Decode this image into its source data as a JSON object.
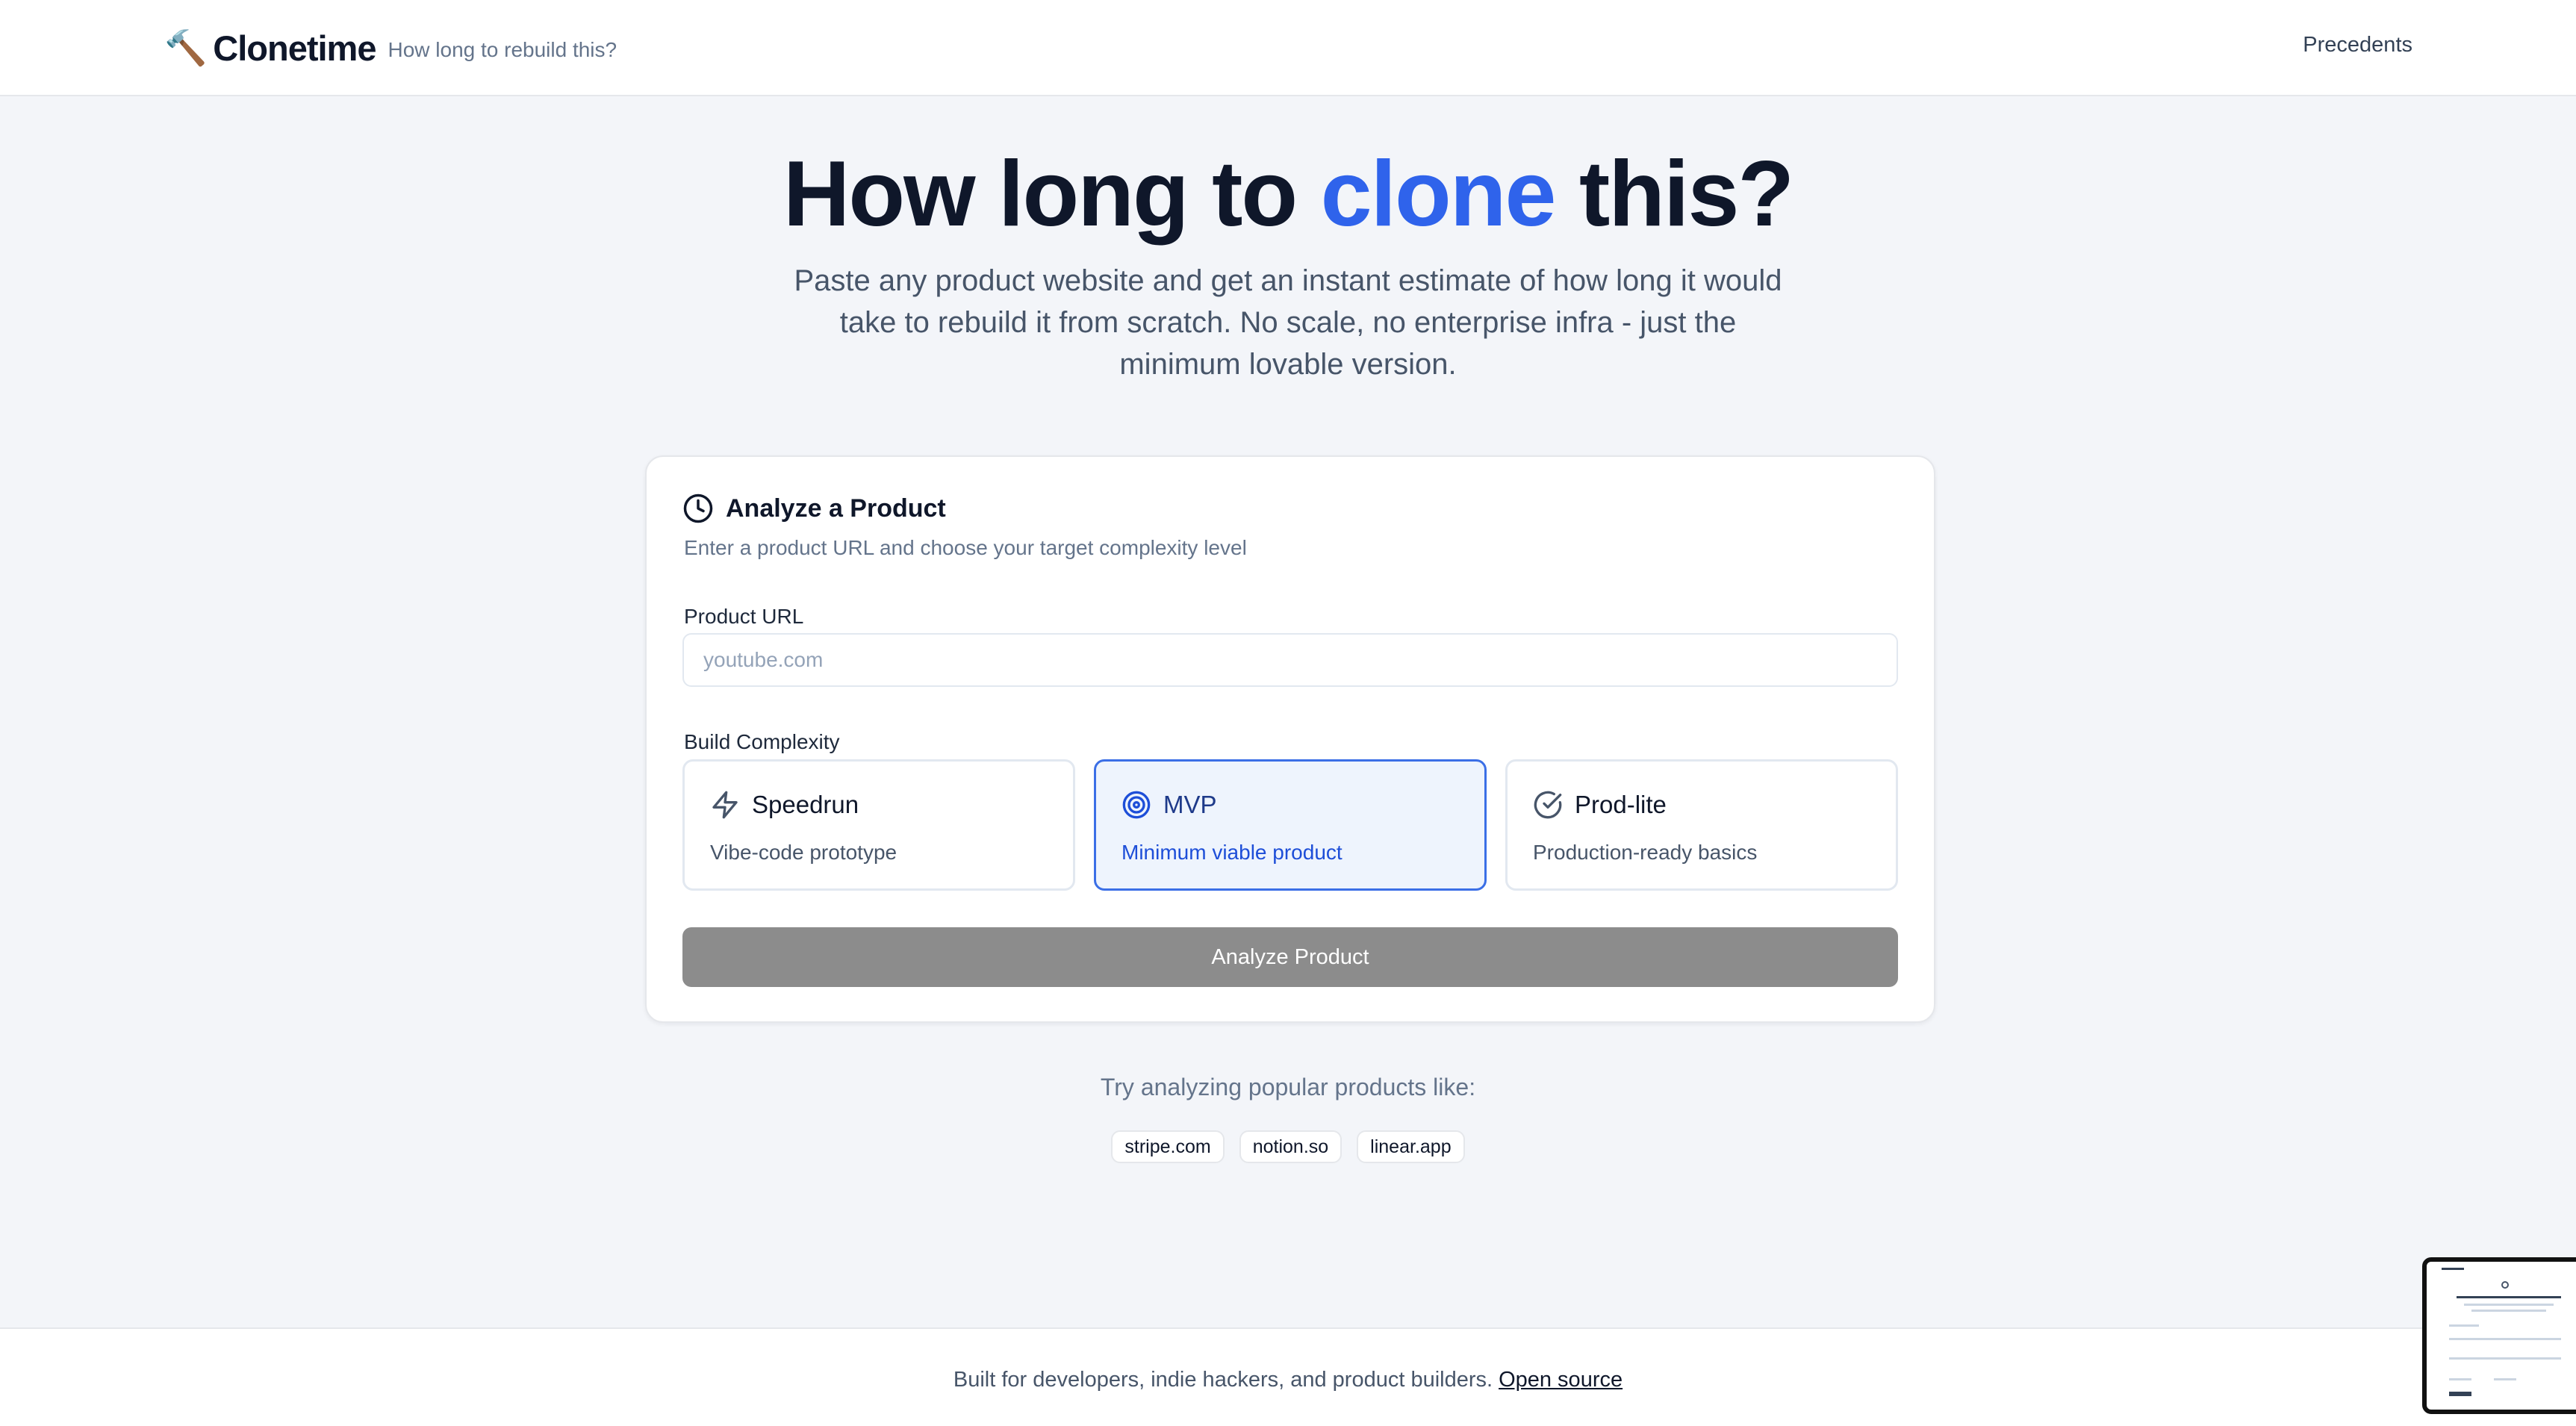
{
  "header": {
    "brand_icon": "🔨",
    "brand_name": "Clonetime",
    "tagline": "How long to rebuild this?",
    "nav_link": "Precedents"
  },
  "hero": {
    "title_pre": "How long to ",
    "title_accent": "clone",
    "title_post": " this?",
    "subtitle": "Paste any product website and get an instant estimate of how long it would take to rebuild it from scratch. No scale, no enterprise infra - just the minimum lovable version."
  },
  "card": {
    "icon": "clock-icon",
    "title": "Analyze a Product",
    "description": "Enter a product URL and choose your target complexity level",
    "url_label": "Product URL",
    "url_placeholder": "youtube.com",
    "url_value": "",
    "complexity_label": "Build Complexity",
    "options": [
      {
        "icon": "zap-icon",
        "title": "Speedrun",
        "subtitle": "Vibe-code prototype",
        "selected": false
      },
      {
        "icon": "target-icon",
        "title": "MVP",
        "subtitle": "Minimum viable product",
        "selected": true
      },
      {
        "icon": "check-circle-icon",
        "title": "Prod-lite",
        "subtitle": "Production-ready basics",
        "selected": false
      }
    ],
    "analyze_label": "Analyze Product"
  },
  "examples": {
    "label": "Try analyzing popular products like:",
    "chips": [
      "stripe.com",
      "notion.so",
      "linear.app"
    ]
  },
  "footer": {
    "text": "Built for developers, indie hackers, and product builders.",
    "link": "Open source"
  },
  "colors": {
    "accent": "#2f63eb",
    "selected_border": "#3b6fe6",
    "selected_bg": "#eef4fd",
    "button_disabled": "#8c8c8c"
  }
}
